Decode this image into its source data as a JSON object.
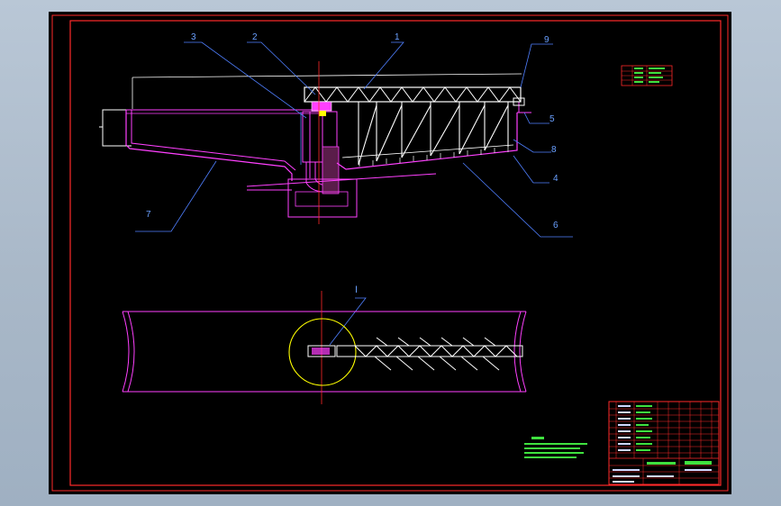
{
  "drawing": {
    "callouts": {
      "c1": "1",
      "c2": "2",
      "c3": "3",
      "c4": "4",
      "c5": "5",
      "c6": "6",
      "c7": "7",
      "c8": "8",
      "c9": "9",
      "detail": "Ⅰ"
    }
  },
  "colors": {
    "frame": "#ff2a2a",
    "structure": "#ff40ff",
    "truss": "#ffffff",
    "leader": "#4f7fff",
    "detail_circle": "#ffff00",
    "notes": "#3fe23f"
  }
}
